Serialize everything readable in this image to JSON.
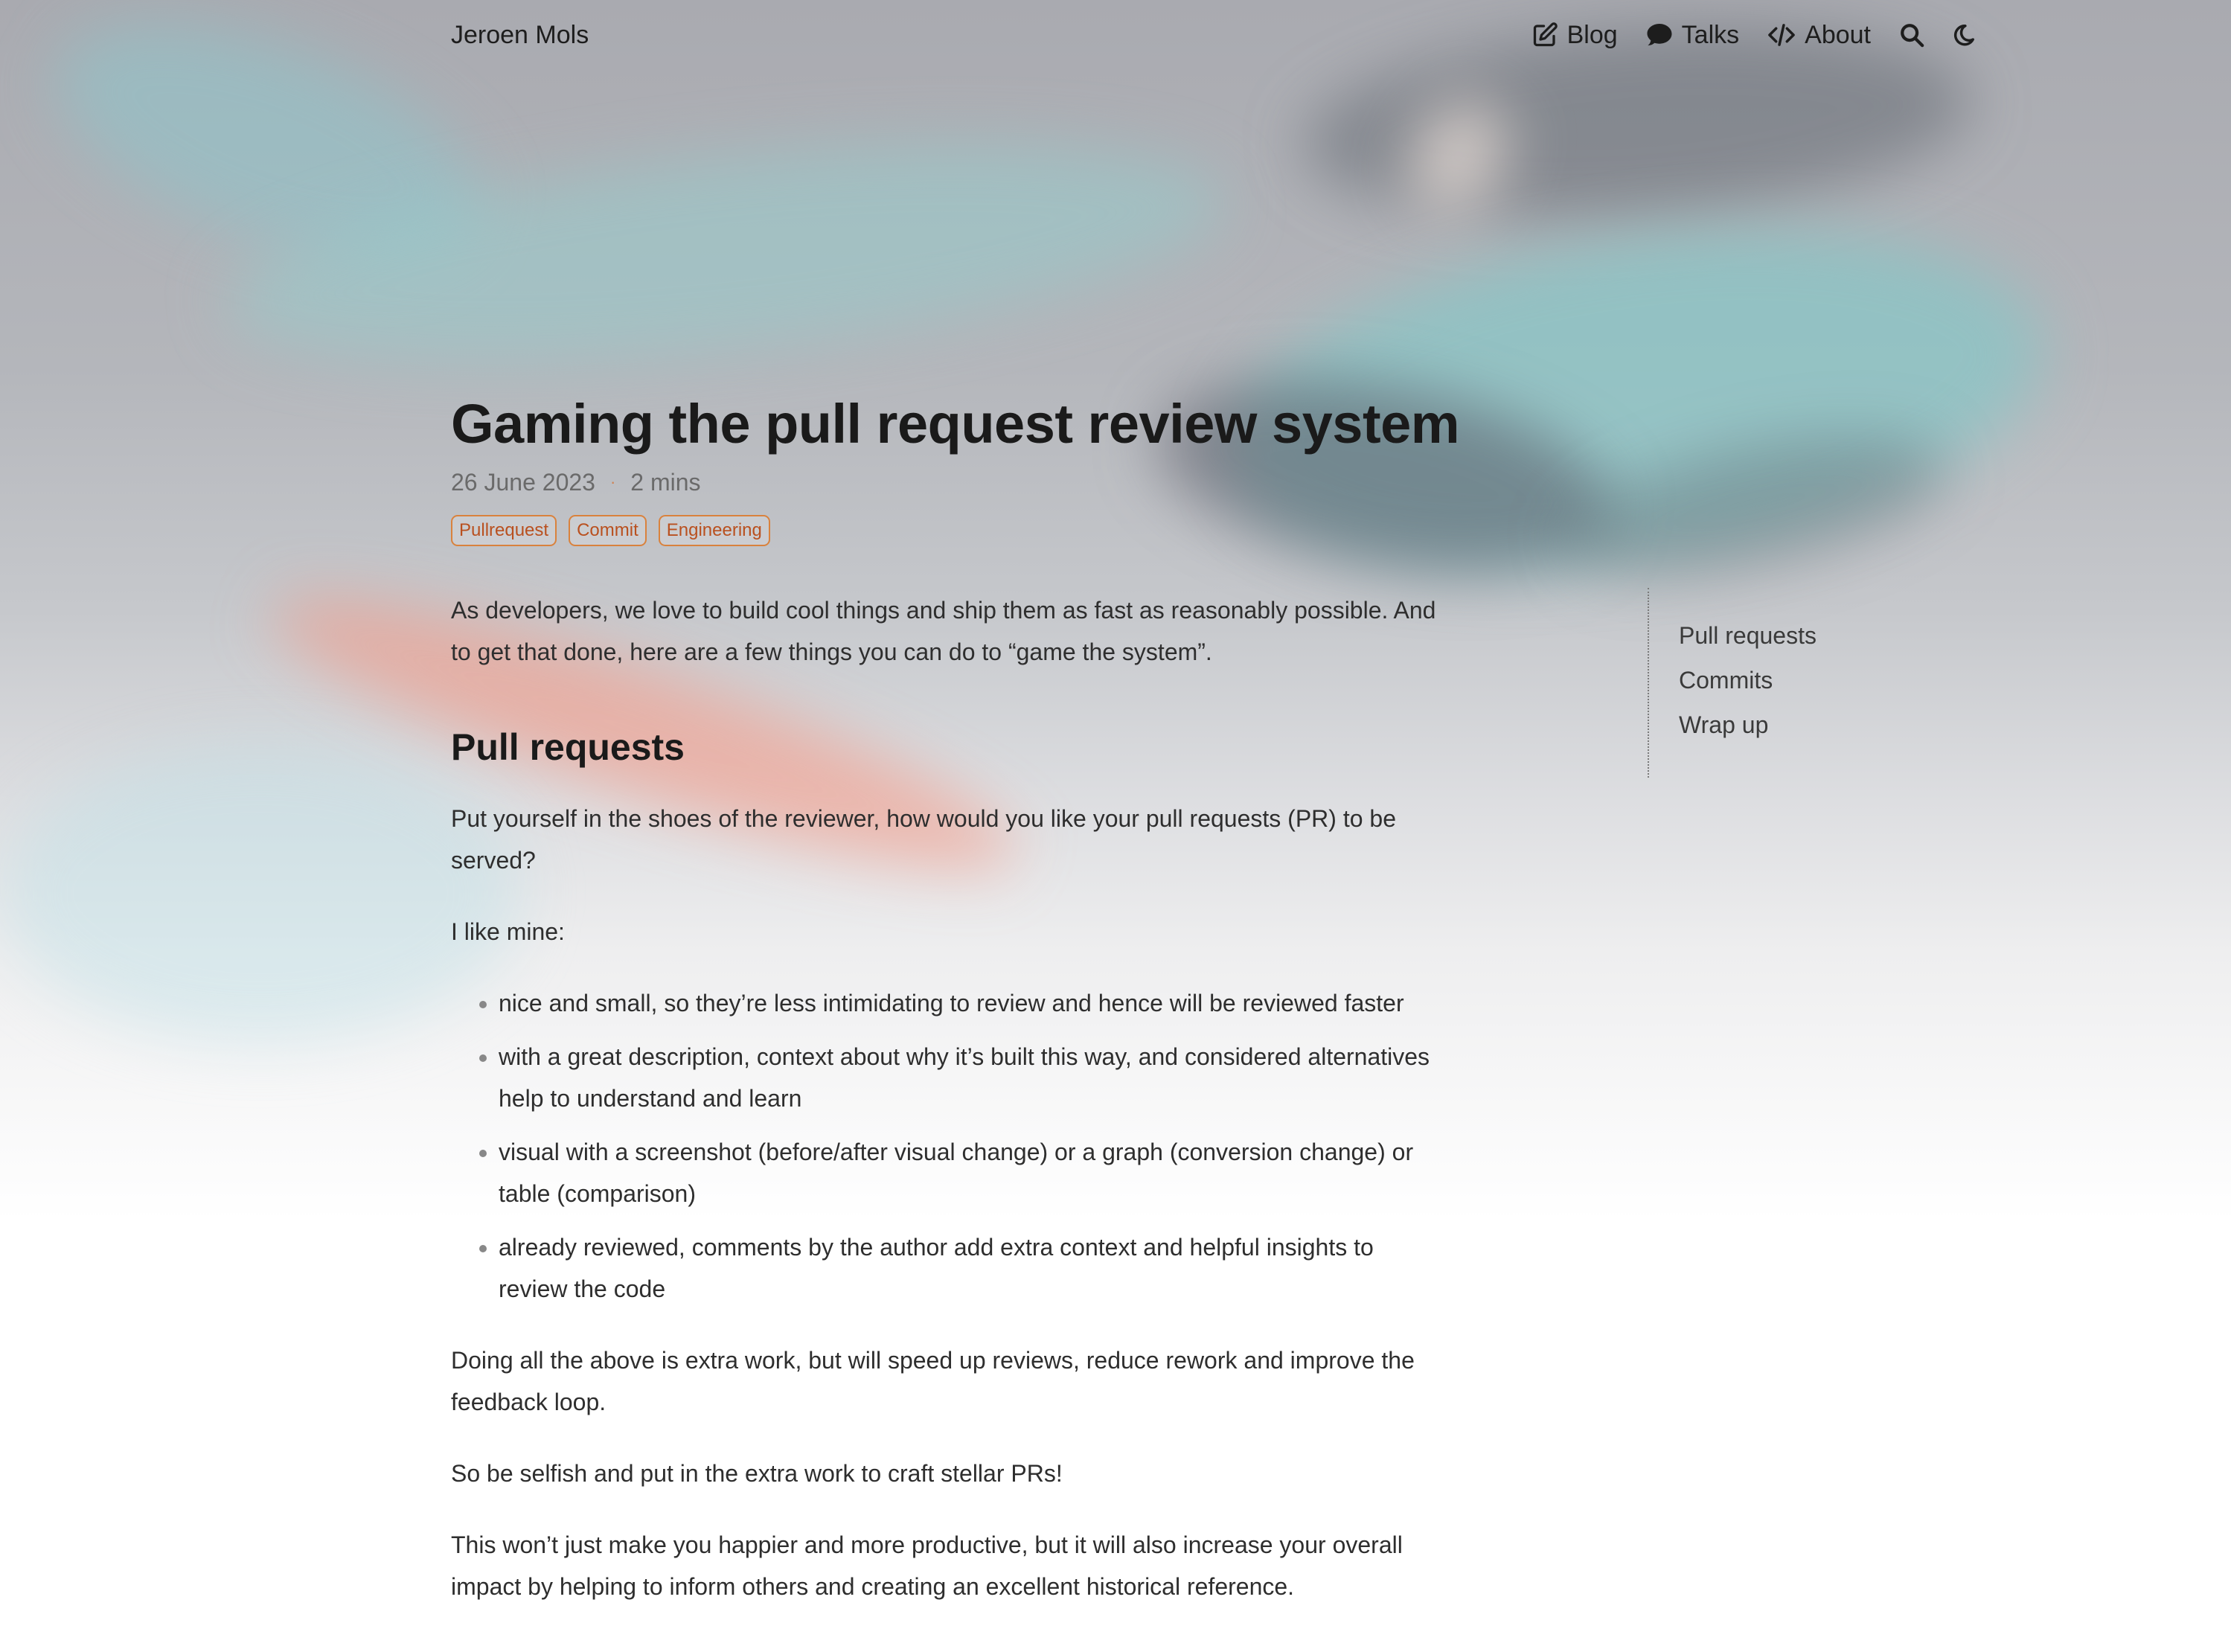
{
  "header": {
    "site_name": "Jeroen Mols",
    "nav": [
      {
        "label": "Blog",
        "icon": "edit-icon"
      },
      {
        "label": "Talks",
        "icon": "speech-bubble-icon"
      },
      {
        "label": "About",
        "icon": "code-icon"
      }
    ],
    "search_icon": "search-icon",
    "theme_icon": "moon-icon"
  },
  "article": {
    "title": "Gaming the pull request review system",
    "date": "26 June 2023",
    "separator": "·",
    "reading_time": "2 mins",
    "tags": [
      "Pullrequest",
      "Commit",
      "Engineering"
    ],
    "intro": "As developers, we love to build cool things and ship them as fast as reasonably possible. And to get that done, here are a few things you can do to “game the system”.",
    "section_heading": "Pull requests",
    "paragraph_1": "Put yourself in the shoes of the reviewer, how would you like your pull requests (PR) to be served?",
    "paragraph_2": "I like mine:",
    "bullets": [
      "nice and small, so they’re less intimidating to review and hence will be reviewed faster",
      "with a great description, context about why it’s built this way, and considered alternatives help to understand and learn",
      "visual with a screenshot (before/after visual change) or a graph (conversion change) or table (comparison)",
      "already reviewed, comments by the author add extra context and helpful insights to review the code"
    ],
    "paragraph_3": "Doing all the above is extra work, but will speed up reviews, reduce rework and improve the feedback loop.",
    "paragraph_4": "So be selfish and put in the extra work to craft stellar PRs!",
    "paragraph_5": "This won’t just make you happier and more productive, but it will also increase your overall impact by helping to inform others and creating an excellent historical reference."
  },
  "toc": {
    "items": [
      "Pull requests",
      "Commits",
      "Wrap up"
    ]
  },
  "colors": {
    "tag_border": "#d9823d",
    "tag_text": "#b9501f",
    "text": "#2e2e2e",
    "heading": "#1a1a1a"
  }
}
